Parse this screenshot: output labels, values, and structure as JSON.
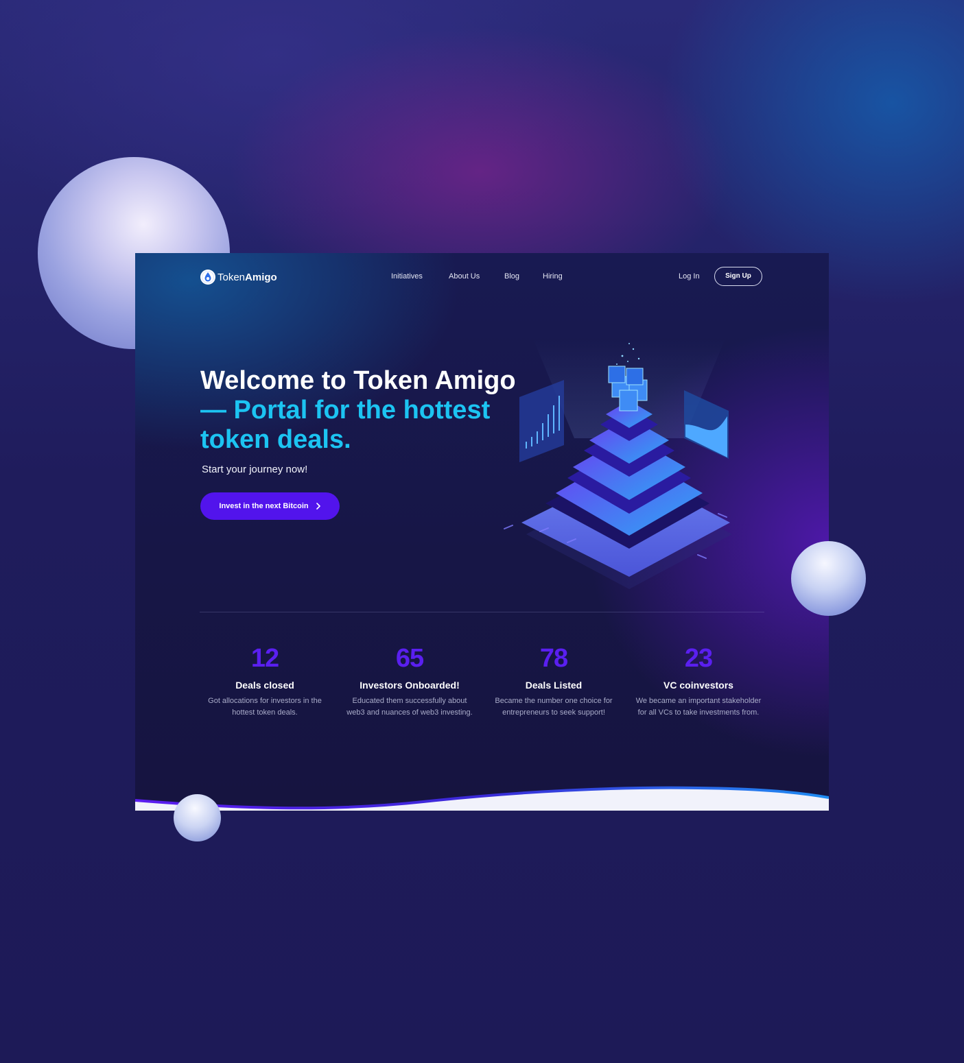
{
  "brand": {
    "name_light": "Token",
    "name_bold": "Amigo"
  },
  "nav": {
    "links": [
      "Initiatives",
      "About Us",
      "Blog",
      "Hiring"
    ],
    "login": "Log In",
    "signup": "Sign Up"
  },
  "hero": {
    "title_white": "Welcome to Token Amigo",
    "title_accent": "— Portal for the hottest token deals.",
    "subtitle": "Start your journey now!",
    "cta": "Invest in the next Bitcoin"
  },
  "stats": [
    {
      "value": "12",
      "label": "Deals closed",
      "desc": "Got allocations for investors in the hottest token deals."
    },
    {
      "value": "65",
      "label": "Investors Onboarded!",
      "desc": "Educated them successfully about web3 and nuances of web3 investing."
    },
    {
      "value": "78",
      "label": "Deals Listed",
      "desc": "Became the number one choice for entrepreneurs to seek support!"
    },
    {
      "value": "23",
      "label": "VC coinvestors",
      "desc": "We became an important stakeholder for all VCs to take investments from."
    }
  ],
  "colors": {
    "accent_cyan": "#1cc4f2",
    "primary_purple": "#5214ec",
    "stat_purple": "#5a1ff0",
    "background": "#1d1a57"
  }
}
